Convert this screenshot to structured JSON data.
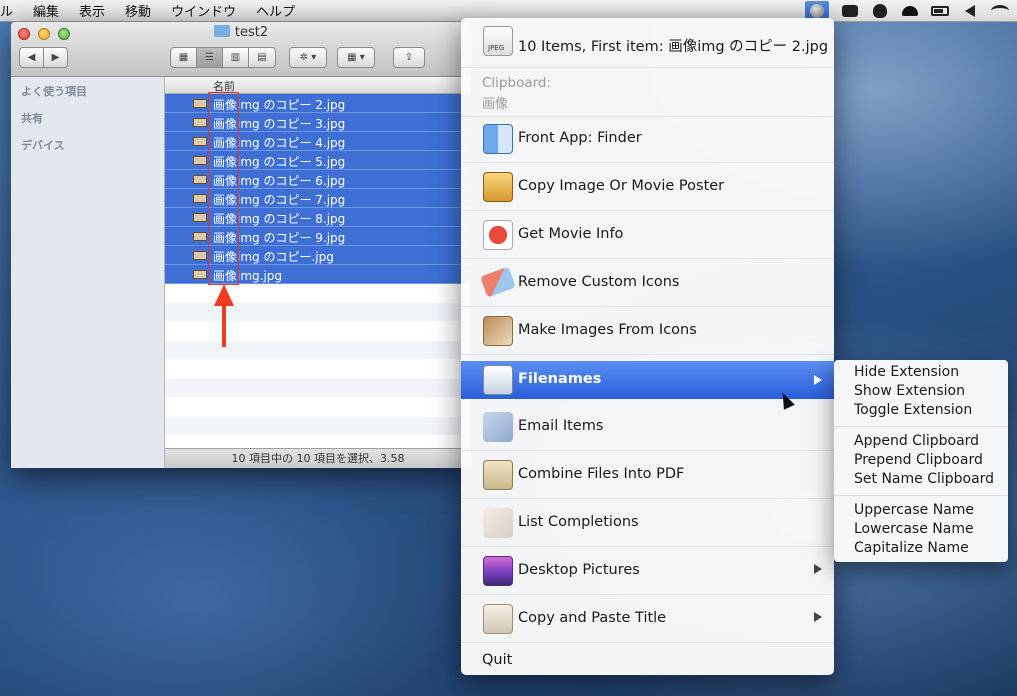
{
  "menubar": {
    "items": [
      "ル",
      "編集",
      "表示",
      "移動",
      "ウインドウ",
      "ヘルプ"
    ]
  },
  "finder": {
    "title": "test2",
    "sidebar_sections": [
      "よく使う項目",
      "共有",
      "デバイス"
    ],
    "column_name": "名前",
    "files": [
      "画像img のコピー 2.jpg",
      "画像img のコピー 3.jpg",
      "画像img のコピー 4.jpg",
      "画像img のコピー 5.jpg",
      "画像img のコピー 6.jpg",
      "画像img のコピー 7.jpg",
      "画像img のコピー 8.jpg",
      "画像img のコピー 9.jpg",
      "画像img のコピー.jpg",
      "画像img.jpg"
    ],
    "status": "10 項目中の 10 項目を選択、3.58"
  },
  "menu": {
    "header": "10 Items, First item: 画像img のコピー 2.jpg",
    "clipboard_label": "Clipboard:",
    "clipboard_value": "画像",
    "items": [
      {
        "label": "Front App: Finder",
        "icon": "finder-icon",
        "submenu": false
      },
      {
        "label": "Copy Image Or Movie Poster",
        "icon": "clipboard-icon",
        "submenu": false
      },
      {
        "label": "Get Movie Info",
        "icon": "movie-icon",
        "submenu": false
      },
      {
        "label": "Remove Custom Icons",
        "icon": "eraser-icon",
        "submenu": false
      },
      {
        "label": "Make Images From Icons",
        "icon": "image-maker-icon",
        "submenu": false
      },
      {
        "label": "Filenames",
        "icon": "filenames-icon",
        "submenu": true,
        "highlighted": true
      },
      {
        "label": "Email Items",
        "icon": "email-icon",
        "submenu": false
      },
      {
        "label": "Combine Files Into PDF",
        "icon": "pdf-icon",
        "submenu": false
      },
      {
        "label": "List Completions",
        "icon": "list-icon",
        "submenu": false
      },
      {
        "label": "Desktop Pictures",
        "icon": "desktop-pictures-icon",
        "submenu": true
      },
      {
        "label": "Copy and Paste Title",
        "icon": "paste-title-icon",
        "submenu": true
      }
    ],
    "quit": "Quit"
  },
  "submenu": {
    "group1": [
      "Hide Extension",
      "Show Extension",
      "Toggle Extension"
    ],
    "group2": [
      "Append Clipboard",
      "Prepend Clipboard",
      "Set Name Clipboard"
    ],
    "group3": [
      "Uppercase Name",
      "Lowercase Name",
      "Capitalize Name"
    ]
  },
  "colors": {
    "selection": "#3d6fd4",
    "menu_highlight": "#2a5fdc",
    "annotation_red": "#ee3b22"
  }
}
